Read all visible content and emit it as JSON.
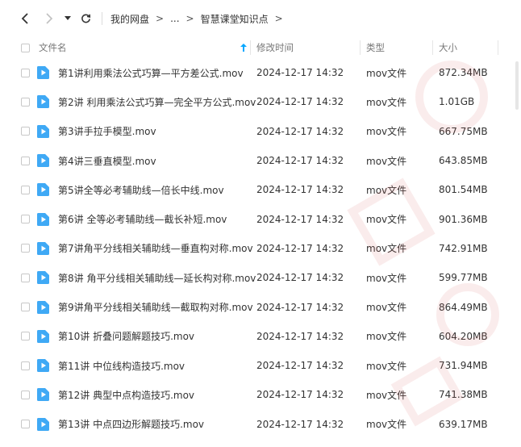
{
  "breadcrumb": {
    "root": "我的网盘",
    "sep": ">",
    "ellipsis": "...",
    "current": "智慧课堂知识点"
  },
  "columns": {
    "name": "文件名",
    "modified": "修改时间",
    "type": "类型",
    "size": "大小"
  },
  "files": [
    {
      "name": "第1讲利用乘法公式巧算—平方差公式.mov",
      "modified": "2024-12-17 14:32",
      "type": "mov文件",
      "size": "872.34MB"
    },
    {
      "name": "第2讲 利用乘法公式巧算—完全平方公式.mov",
      "modified": "2024-12-17 14:32",
      "type": "mov文件",
      "size": "1.01GB"
    },
    {
      "name": "第3讲手拉手模型.mov",
      "modified": "2024-12-17 14:32",
      "type": "mov文件",
      "size": "667.75MB"
    },
    {
      "name": "第4讲三垂直模型.mov",
      "modified": "2024-12-17 14:32",
      "type": "mov文件",
      "size": "643.85MB"
    },
    {
      "name": "第5讲全等必考辅助线—倍长中线.mov",
      "modified": "2024-12-17 14:32",
      "type": "mov文件",
      "size": "801.54MB"
    },
    {
      "name": "第6讲 全等必考辅助线—截长补短.mov",
      "modified": "2024-12-17 14:32",
      "type": "mov文件",
      "size": "901.36MB"
    },
    {
      "name": "第7讲角平分线相关辅助线—垂直构对称.mov",
      "modified": "2024-12-17 14:32",
      "type": "mov文件",
      "size": "742.91MB"
    },
    {
      "name": "第8讲 角平分线相关辅助线—延长构对称.mov",
      "modified": "2024-12-17 14:32",
      "type": "mov文件",
      "size": "599.77MB"
    },
    {
      "name": "第9讲角平分线相关辅助线—截取构对称.mov",
      "modified": "2024-12-17 14:32",
      "type": "mov文件",
      "size": "864.49MB"
    },
    {
      "name": "第10讲 折叠问题解题技巧.mov",
      "modified": "2024-12-17 14:32",
      "type": "mov文件",
      "size": "604.20MB"
    },
    {
      "name": "第11讲 中位线构造技巧.mov",
      "modified": "2024-12-17 14:32",
      "type": "mov文件",
      "size": "731.94MB"
    },
    {
      "name": "第12讲 典型中点构造技巧.mov",
      "modified": "2024-12-17 14:32",
      "type": "mov文件",
      "size": "741.38MB"
    },
    {
      "name": "第13讲 中点四边形解题技巧.mov",
      "modified": "2024-12-17 14:32",
      "type": "mov文件",
      "size": "639.17MB"
    }
  ],
  "colors": {
    "accent": "#06a7ff",
    "file_icon": "#3fa9f5"
  }
}
